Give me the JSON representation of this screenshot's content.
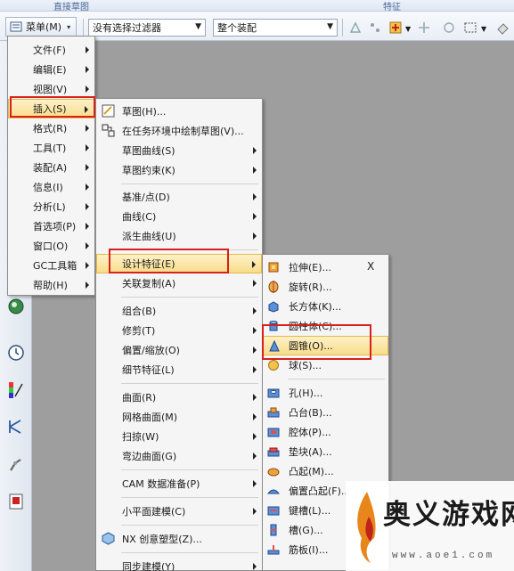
{
  "ribbon": {
    "group_left": "直接草图",
    "group_right": "特征"
  },
  "toolbar": {
    "menu_label": "菜单(M)",
    "filter_value": "没有选择过滤器",
    "assembly_value": "整个装配"
  },
  "main_menu": {
    "items": [
      {
        "label": "文件(F)"
      },
      {
        "label": "编辑(E)"
      },
      {
        "label": "视图(V)"
      },
      {
        "label": "插入(S)"
      },
      {
        "label": "格式(R)"
      },
      {
        "label": "工具(T)"
      },
      {
        "label": "装配(A)"
      },
      {
        "label": "信息(I)"
      },
      {
        "label": "分析(L)"
      },
      {
        "label": "首选项(P)"
      },
      {
        "label": "窗口(O)"
      },
      {
        "label": "GC工具箱"
      },
      {
        "label": "帮助(H)"
      }
    ]
  },
  "insert_menu": {
    "items": [
      {
        "label": "草图(H)..."
      },
      {
        "label": "在任务环境中绘制草图(V)..."
      },
      {
        "label": "草图曲线(S)"
      },
      {
        "label": "草图约束(K)"
      },
      {
        "label": "基准/点(D)"
      },
      {
        "label": "曲线(C)"
      },
      {
        "label": "派生曲线(U)"
      },
      {
        "label": "设计特征(E)"
      },
      {
        "label": "关联复制(A)"
      },
      {
        "label": "组合(B)"
      },
      {
        "label": "修剪(T)"
      },
      {
        "label": "偏置/缩放(O)"
      },
      {
        "label": "细节特征(L)"
      },
      {
        "label": "曲面(R)"
      },
      {
        "label": "网格曲面(M)"
      },
      {
        "label": "扫掠(W)"
      },
      {
        "label": "弯边曲面(G)"
      },
      {
        "label": "CAM 数据准备(P)"
      },
      {
        "label": "小平面建模(C)"
      },
      {
        "label": "NX 创意塑型(Z)..."
      },
      {
        "label": "同步建模(Y)"
      }
    ]
  },
  "design_menu": {
    "close": "X",
    "items": [
      {
        "label": "拉伸(E)..."
      },
      {
        "label": "旋转(R)..."
      },
      {
        "label": "长方体(K)..."
      },
      {
        "label": "圆柱体(C)..."
      },
      {
        "label": "圆锥(O)..."
      },
      {
        "label": "球(S)..."
      },
      {
        "label": "孔(H)..."
      },
      {
        "label": "凸台(B)..."
      },
      {
        "label": "腔体(P)..."
      },
      {
        "label": "垫块(A)..."
      },
      {
        "label": "凸起(M)..."
      },
      {
        "label": "偏置凸起(F)..."
      },
      {
        "label": "键槽(L)..."
      },
      {
        "label": "槽(G)..."
      },
      {
        "label": "筋板(I)..."
      }
    ]
  },
  "watermark": {
    "title": "奥义游戏网",
    "url": "www.aoe1.com"
  },
  "colors": {
    "highlight_box": "#d9201a",
    "menu_bg": "#f5f5f5",
    "canvas": "#9e9e9e"
  }
}
